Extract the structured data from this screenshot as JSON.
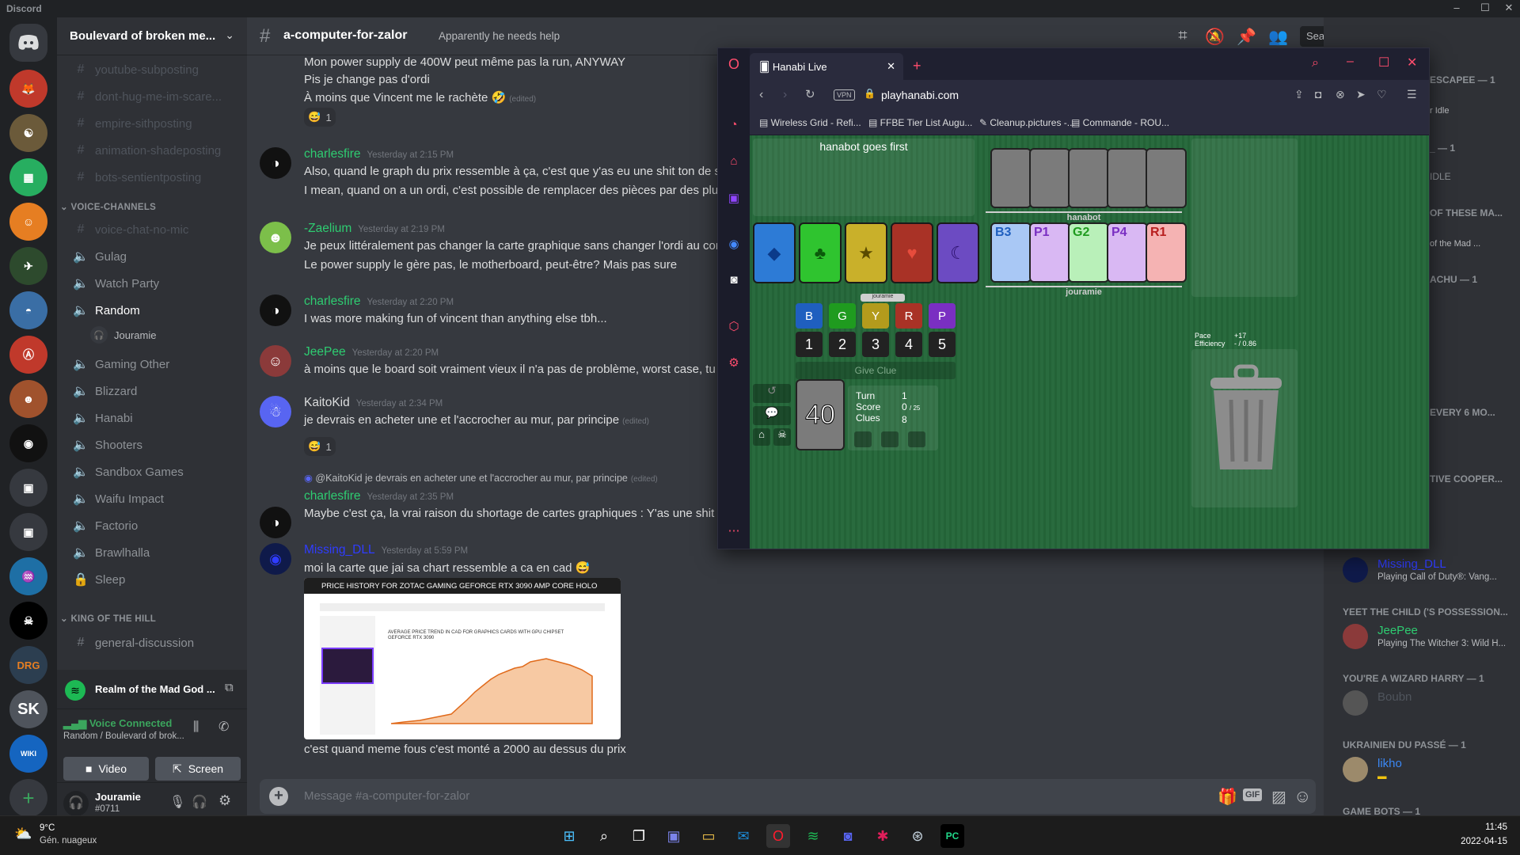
{
  "window": {
    "title": "Discord"
  },
  "server": {
    "name": "Boulevard of broken me..."
  },
  "channels": {
    "muted_text": [
      "youtube-subposting",
      "dont-hug-me-im-scare...",
      "empire-sithposting",
      "animation-shadeposting",
      "bots-sentientposting"
    ],
    "voice_category": "VOICE-CHANNELS",
    "voice_muted": "voice-chat-no-mic",
    "voice": [
      "Gulag",
      "Watch Party",
      "Random",
      "Gaming Other",
      "Blizzard",
      "Hanabi",
      "Shooters",
      "Sandbox Games",
      "Waifu Impact",
      "Factorio",
      "Brawlhalla",
      "Sleep"
    ],
    "voice_user": "Jouramie",
    "koth_category": "KING OF THE HILL",
    "koth_channel": "general-discussion"
  },
  "activity": {
    "text": "Realm of the Mad God ..."
  },
  "voice": {
    "status": "Voice Connected",
    "location": "Random / Boulevard of brok...",
    "video": "Video",
    "screen": "Screen"
  },
  "user": {
    "name": "Jouramie",
    "tag": "#0711"
  },
  "chat": {
    "channel": "a-computer-for-zalor",
    "topic": "Apparently he needs help",
    "search_placeholder": "Search",
    "composer_placeholder": "Message #a-computer-for-zalor",
    "top_lines": [
      "Mon power supply de 400W peut même pas la run, ANYWAY",
      "Pis je change pas d'ordi",
      "À moins que Vincent me le rachète 🤣"
    ],
    "top_reaction": "1",
    "edited": "(edited)",
    "messages": [
      {
        "author": "charlesfire",
        "color": "#2ecc71",
        "time": "Yesterday at 2:15 PM",
        "lines": [
          "Also, quand le graph du prix ressemble à ça, c'est que y'as eu une shit ton de sh",
          "I mean, quand on a un ordi, c'est possible de remplacer des pièces par des plus"
        ]
      },
      {
        "author": "-Zaelium",
        "color": "#2ecc71",
        "time": "Yesterday at 2:19 PM",
        "lines": [
          "Je peux littéralement pas changer la carte graphique sans changer l'ordi au com",
          "Le power supply le gère pas, le motherboard, peut-être? Mais pas sure"
        ]
      },
      {
        "author": "charlesfire",
        "color": "#2ecc71",
        "time": "Yesterday at 2:20 PM",
        "lines": [
          "I was more making fun of vincent than anything else tbh..."
        ]
      },
      {
        "author": "JeePee",
        "color": "#2ecc71",
        "time": "Yesterday at 2:20 PM",
        "lines": [
          "à moins que le board soit vraiment vieux il n'a pas de problème, worst case, tu v"
        ]
      },
      {
        "author": "KaitoKid",
        "color": "#dcddde",
        "time": "Yesterday at 2:34 PM",
        "lines": [
          "je devrais en acheter une et l'accrocher au mur, par principe"
        ],
        "reaction": "1"
      },
      {
        "author": "charlesfire",
        "color": "#2ecc71",
        "time": "Yesterday at 2:35 PM",
        "reply": "@KaitoKid je devrais en acheter une et l'accrocher au mur, par principe",
        "lines": [
          "Maybe c'est ça, la vrai raison du shortage de cartes graphiques : Y'as une shit to"
        ]
      },
      {
        "author": "Missing_DLL",
        "color": "#2f3cff",
        "time": "Yesterday at 5:59 PM",
        "lines": [
          "moi la carte que jai sa chart ressemble a ca en cad 😅"
        ],
        "image_caption": "PRICE HISTORY FOR ZOTAC GAMING GEFORCE RTX 3090 AMP CORE HOLO",
        "image_subtitle": "AVERAGE PRICE TREND IN CAD FOR GRAPHICS CARDS WITH GPU CHIPSET GEFORCE RTX 3090",
        "after": "c'est quand meme fous c'est monté a 2000 au dessus du prix"
      }
    ]
  },
  "members": {
    "groups": [
      {
        "label": "ESCAPEE — 1",
        "name": "",
        "activity": "r Idle"
      },
      {
        "label": "_ — 1",
        "name": "",
        "activity": "IDLE"
      },
      {
        "label": "OF THESE MA...",
        "name": "",
        "activity": "of the Mad ..."
      },
      {
        "label": "ACHU — 1",
        "name": "",
        "activity": ""
      },
      {
        "label": "EVERY 6 MO...",
        "name": "",
        "activity": ""
      },
      {
        "label": "TIVE COOPER...",
        "name": "",
        "activity": ""
      }
    ],
    "list": [
      {
        "category": "",
        "name": "Missing_DLL",
        "name_color": "#2f3cff",
        "activity": "Playing Call of Duty®: Vang..."
      },
      {
        "category": "YEET THE CHILD ('S POSSESSION...",
        "name": "JeePee",
        "name_color": "#2ecc71",
        "activity": "Playing The Witcher 3: Wild H..."
      },
      {
        "category": "YOU'RE A WIZARD HARRY — 1",
        "name": "Boubn",
        "name_color": "#4f545c",
        "activity": ""
      },
      {
        "category": "UKRAINIEN DU PASSÉ — 1",
        "name": "likho",
        "name_color": "#3b88f5",
        "activity": ""
      },
      {
        "category": "GAME BOTS — 1",
        "name": "",
        "name_color": "",
        "activity": ""
      }
    ]
  },
  "browser": {
    "tab_title": "Hanabi Live",
    "url": "playhanabi.com",
    "vpn": "VPN",
    "bookmarks": [
      "Wireless Grid - Refi...",
      "FFBE Tier List Augu...",
      "Cleanup.pictures -...",
      "Commande - ROU..."
    ]
  },
  "hanabi": {
    "status": "hanabot goes first",
    "partner": "hanabot",
    "me": "jouramie",
    "stacks": [
      {
        "suit": "◆",
        "color": "#2d7bd6"
      },
      {
        "suit": "♣",
        "color": "#2fc42f"
      },
      {
        "suit": "★",
        "color": "#c9b02a"
      },
      {
        "suit": "♥",
        "color": "#c0392b"
      },
      {
        "suit": "☾",
        "color": "#7d4fd6"
      }
    ],
    "my_hand": [
      {
        "label": "B3",
        "color": "#a9c8f5",
        "ink": "#1f5fbf"
      },
      {
        "label": "P1",
        "color": "#d9b8f3",
        "ink": "#7a2fc2"
      },
      {
        "label": "G2",
        "color": "#b9f0b9",
        "ink": "#1f9b1f"
      },
      {
        "label": "P4",
        "color": "#d9b8f3",
        "ink": "#7a2fc2"
      },
      {
        "label": "R1",
        "color": "#f5b3b3",
        "ink": "#b81f1f"
      }
    ],
    "color_clues": [
      "B",
      "G",
      "Y",
      "R",
      "P"
    ],
    "rank_clues": [
      "1",
      "2",
      "3",
      "4",
      "5"
    ],
    "give_clue": "Give Clue",
    "deck_count": "40",
    "turn_label": "Turn",
    "turn": "1",
    "score_label": "Score",
    "score": "0",
    "score_max": "/ 25",
    "clues_label": "Clues",
    "clues": "8",
    "pace_label": "Pace",
    "pace": "+17",
    "eff_label": "Efficiency",
    "eff": "- / 0.86",
    "clue_tab": "jouramie"
  },
  "taskbar": {
    "weather_temp": "9°C",
    "weather_desc": "Gén. nuageux",
    "time": "11:45",
    "date": "2022-04-15"
  }
}
